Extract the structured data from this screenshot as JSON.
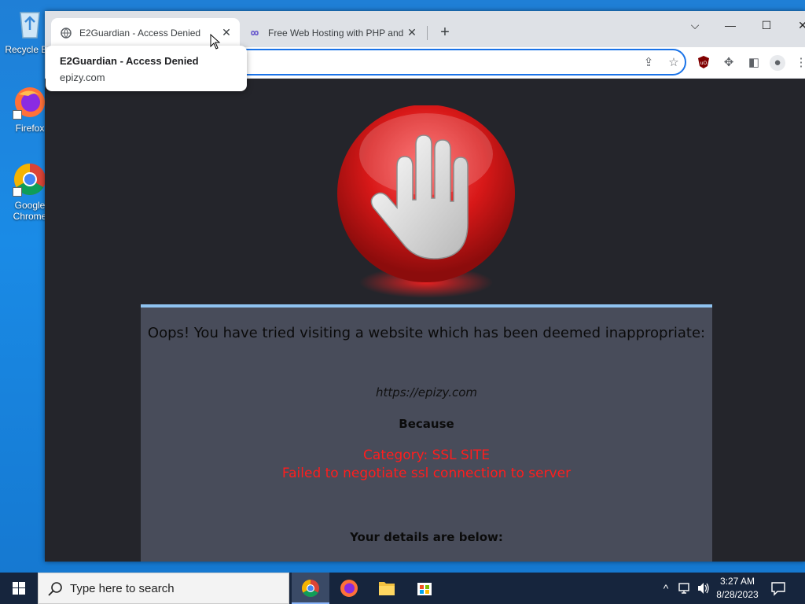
{
  "desktop": {
    "icons": [
      {
        "label": "Recycle Bin"
      },
      {
        "label": "Firefox"
      },
      {
        "label": "Google Chrome"
      }
    ]
  },
  "browser": {
    "tabs": [
      {
        "title": "E2Guardian - Access Denied",
        "favicon": "globe-icon",
        "active": true
      },
      {
        "title": "Free Web Hosting with PHP and MySQL",
        "favicon": "infinity-icon",
        "active": false
      }
    ],
    "newtab_label": "+",
    "hovercard": {
      "title": "E2Guardian - Access Denied",
      "url": "epizy.com"
    },
    "toolbar_icons": [
      "share-icon",
      "star-icon",
      "ublock-icon",
      "extensions-icon",
      "sidepanel-icon",
      "profile-icon",
      "menu-icon"
    ]
  },
  "page": {
    "headline": "Oops! You have tried visiting a website which has been deemed inappropriate:",
    "blocked_url": "https://epizy.com",
    "because_label": "Because",
    "reason_category": "Category: SSL SITE",
    "reason_detail": "Failed to negotiate ssl connection to server",
    "details_label": "Your details are below:"
  },
  "taskbar": {
    "search_placeholder": "Type here to search",
    "apps": [
      "chrome-icon",
      "firefox-icon",
      "file-explorer-icon",
      "store-icon"
    ],
    "time": "3:27 AM",
    "date": "8/28/2023"
  },
  "colors": {
    "accent": "#1a73e8",
    "reason": "#ff1d1d",
    "panel": "#484c5a",
    "page_bg": "#24252b"
  }
}
